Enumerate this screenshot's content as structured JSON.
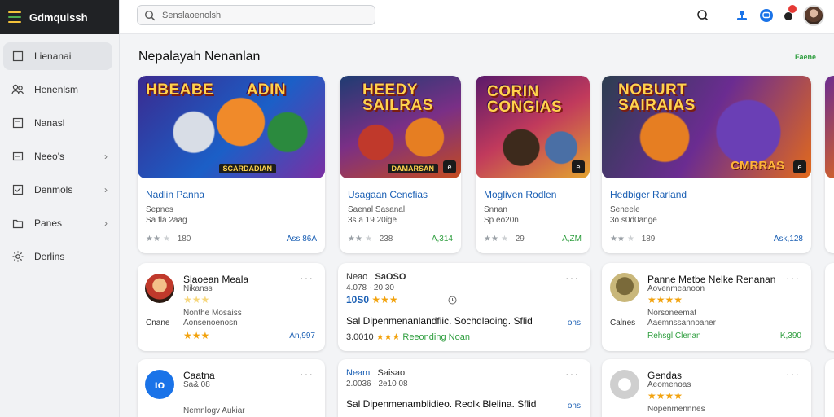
{
  "app": {
    "title": "Gdmquissh"
  },
  "colors": {
    "accent": "#1a5fb4",
    "brand_bg": "#202225",
    "positive": "#2e9e3e",
    "star": "#f2a20c"
  },
  "sidebar": {
    "items": [
      {
        "label": "Lienanai",
        "icon": "square-icon",
        "active": true,
        "chevron": ""
      },
      {
        "label": "Henenlsm",
        "icon": "people-icon",
        "active": false,
        "chevron": ""
      },
      {
        "label": "Nanasl",
        "icon": "square-icon",
        "active": false,
        "chevron": ""
      },
      {
        "label": "Neeo's",
        "icon": "window-icon",
        "active": false,
        "chevron": "›"
      },
      {
        "label": "Denmols",
        "icon": "check-square-icon",
        "active": false,
        "chevron": "›"
      },
      {
        "label": "Panes",
        "icon": "folder-icon",
        "active": false,
        "chevron": "›"
      },
      {
        "label": "Derlins",
        "icon": "gear-icon",
        "active": false,
        "chevron": ""
      }
    ]
  },
  "search": {
    "placeholder": "Senslaoenolsh"
  },
  "section": {
    "title": "Nepalayah Nenanlan",
    "see_all": "Faene"
  },
  "games": [
    {
      "image_title": "HBEABE",
      "image_title2": "ADIN",
      "image_badge": "SCARDADIAN",
      "name": "Nadlin Panna",
      "meta1": "Sepnes",
      "meta2": "Sa fla 2aag",
      "rating": "180",
      "price": "Ass 86A"
    },
    {
      "image_title": "HEEDY",
      "image_title2": "SAILRAS",
      "image_badge": "DAMARSAN",
      "name": "Usagaan Cencfias",
      "meta1": "Saenal Sasanal",
      "meta2": "3s a 19 20ige",
      "rating": "238",
      "price": "A,314"
    },
    {
      "image_title": "CORIN",
      "image_title2": "CONGIAS",
      "image_badge": "",
      "name": "Mogliven Rodlen",
      "meta1": "Snnan",
      "meta2": "Sp eo20n",
      "rating": "29",
      "price": "A,ZM"
    },
    {
      "image_title": "NOBURT",
      "image_title2": "SAIRAIAS",
      "image_badge": "CMRRAS",
      "name": "Hedbiger Rarland",
      "meta1": "Seneele",
      "meta2": "3o s0d0ange",
      "rating": "189",
      "price": "Ask,128"
    }
  ],
  "reviews_row1": [
    {
      "title": "Slaoean Meala",
      "sub": "Nikanss",
      "stars": "★★★",
      "line1": "Nonthe Mosaiss",
      "line2": "Aonsenoenosn",
      "label": "Cnane",
      "rating2": "★★★",
      "price": "An,997"
    },
    {
      "title": "Neao",
      "title_b": "SaOSO",
      "sub": "4.078 · 20 30",
      "row": "10S0",
      "line": "Sal Dipenmenanlandfiic. Sochdlaoing.",
      "line_b": "Sflid",
      "link": "ons",
      "line2": "3.0010",
      "line2_b": "Reeonding Noan"
    },
    {
      "title": "Panne Metbe Nelke Renanan",
      "sub": "Aovenmeanoon",
      "stars": "★★★★",
      "line1": "Norsoneemat",
      "line2": "Aaemnssannoaner",
      "label": "Calnes",
      "rating2": "Rehsgl Clenan",
      "price": "K,390"
    }
  ],
  "reviews_row2": [
    {
      "title": "Caatna",
      "sub": "Sa& 08",
      "line1": "Nemnlogv Aukiar"
    },
    {
      "title": "Neam",
      "title_b": "Saisao",
      "sub": "2.0036 · 2e10 08",
      "line": "Sal Dipenmenamblidieo. Reolk Blelina.",
      "line_b": "Sflid",
      "link": "ons"
    },
    {
      "title": "Gendas",
      "sub": "Aeomenoas",
      "stars": "★★★★",
      "line1": "Nopenmennnes"
    }
  ]
}
